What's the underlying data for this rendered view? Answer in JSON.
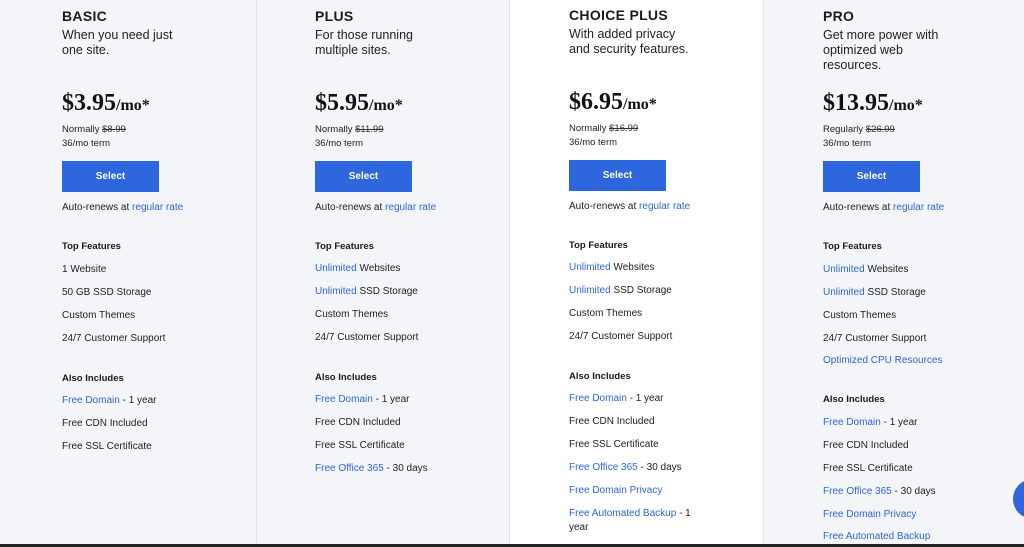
{
  "colors": {
    "accent": "#2d66dd",
    "panel_bg": "#f4f5f8",
    "highlight_bg": "#ffffff"
  },
  "plans": [
    {
      "name": "BASIC",
      "tagline": "When you need just one site.",
      "price": "$3.95",
      "price_suffix": "/mo*",
      "normally_label": "Normally",
      "normally_price": "$8.99",
      "term": "36/mo term",
      "select_label": "Select",
      "renew_text": "Auto-renews at",
      "renew_link": "regular rate",
      "top_features_title": "Top Features",
      "top_features": [
        {
          "link": "",
          "text": "1 Website"
        },
        {
          "link": "",
          "text": "50 GB SSD Storage"
        },
        {
          "link": "",
          "text": "Custom Themes"
        },
        {
          "link": "",
          "text": "24/7 Customer Support"
        }
      ],
      "also_includes_title": "Also Includes",
      "also_includes": [
        {
          "link": "Free Domain",
          "text": " - 1 year"
        },
        {
          "link": "",
          "text": "Free CDN Included"
        },
        {
          "link": "",
          "text": "Free SSL Certificate"
        }
      ]
    },
    {
      "name": "PLUS",
      "tagline": "For those running multiple sites.",
      "price": "$5.95",
      "price_suffix": "/mo*",
      "normally_label": "Normally",
      "normally_price": "$11.99",
      "term": "36/mo term",
      "select_label": "Select",
      "renew_text": "Auto-renews at",
      "renew_link": "regular rate",
      "top_features_title": "Top Features",
      "top_features": [
        {
          "link": "Unlimited",
          "text": " Websites"
        },
        {
          "link": "Unlimited",
          "text": " SSD Storage"
        },
        {
          "link": "",
          "text": "Custom Themes"
        },
        {
          "link": "",
          "text": "24/7 Customer Support"
        }
      ],
      "also_includes_title": "Also Includes",
      "also_includes": [
        {
          "link": "Free Domain",
          "text": " - 1 year"
        },
        {
          "link": "",
          "text": "Free CDN Included"
        },
        {
          "link": "",
          "text": "Free SSL Certificate"
        },
        {
          "link": "Free Office 365",
          "text": " - 30 days"
        }
      ]
    },
    {
      "name": "CHOICE PLUS",
      "tagline": "With added privacy and security features.",
      "price": "$6.95",
      "price_suffix": "/mo*",
      "normally_label": "Normally",
      "normally_price": "$16.99",
      "term": "36/mo term",
      "select_label": "Select",
      "renew_text": "Auto-renews at",
      "renew_link": "regular rate",
      "top_features_title": "Top Features",
      "top_features": [
        {
          "link": "Unlimited",
          "text": " Websites"
        },
        {
          "link": "Unlimited",
          "text": " SSD Storage"
        },
        {
          "link": "",
          "text": "Custom Themes"
        },
        {
          "link": "",
          "text": "24/7 Customer Support"
        }
      ],
      "also_includes_title": "Also Includes",
      "also_includes": [
        {
          "link": "Free Domain",
          "text": " - 1 year"
        },
        {
          "link": "",
          "text": "Free CDN Included"
        },
        {
          "link": "",
          "text": "Free SSL Certificate"
        },
        {
          "link": "Free Office 365",
          "text": " - 30 days"
        },
        {
          "link": "Free Domain Privacy",
          "text": ""
        },
        {
          "link": "Free Automated Backup",
          "text": " - 1 year"
        }
      ]
    },
    {
      "name": "PRO",
      "tagline": "Get more power with optimized web resources.",
      "price": "$13.95",
      "price_suffix": "/mo*",
      "normally_label": "Regularly",
      "normally_price": "$26.99",
      "term": "36/mo term",
      "select_label": "Select",
      "renew_text": "Auto-renews at",
      "renew_link": "regular rate",
      "top_features_title": "Top Features",
      "top_features": [
        {
          "link": "Unlimited",
          "text": " Websites"
        },
        {
          "link": "Unlimited",
          "text": " SSD Storage"
        },
        {
          "link": "",
          "text": "Custom Themes"
        },
        {
          "link": "",
          "text": "24/7 Customer Support"
        },
        {
          "link": "Optimized CPU Resources",
          "text": ""
        }
      ],
      "also_includes_title": "Also Includes",
      "also_includes": [
        {
          "link": "Free Domain",
          "text": " - 1 year"
        },
        {
          "link": "",
          "text": "Free CDN Included"
        },
        {
          "link": "",
          "text": "Free SSL Certificate"
        },
        {
          "link": "Free Office 365",
          "text": " - 30 days"
        },
        {
          "link": "Free Domain Privacy",
          "text": ""
        },
        {
          "link": "Free Automated Backup",
          "text": ""
        }
      ]
    }
  ]
}
